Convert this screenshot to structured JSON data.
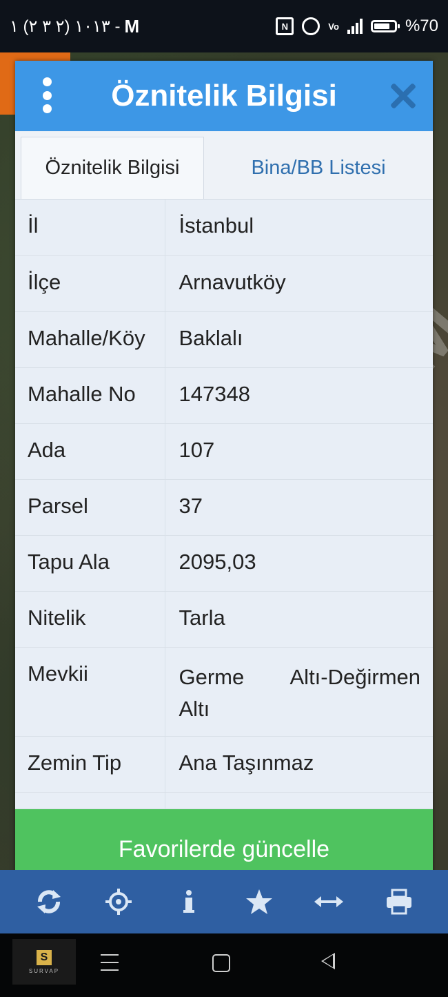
{
  "status_bar": {
    "left_text": "۱ (۲ ۳ ۲) ۱۰۱۳ -",
    "m_icon": "M",
    "battery": "%70",
    "icons": [
      "nfc-icon",
      "alarm-icon",
      "volte-icon",
      "signal-icon",
      "battery-icon"
    ]
  },
  "dialog": {
    "title": "Öznitelik Bilgisi",
    "tabs": [
      {
        "label": "Öznitelik Bilgisi",
        "active": true
      },
      {
        "label": "Bina/BB Listesi",
        "active": false
      }
    ],
    "rows": [
      {
        "key": "İl",
        "value": "İstanbul"
      },
      {
        "key": "İlçe",
        "value": "Arnavutköy"
      },
      {
        "key": "Mahalle/Köy",
        "value": "Baklalı"
      },
      {
        "key": "Mahalle No",
        "value": "147348"
      },
      {
        "key": "Ada",
        "value": "107"
      },
      {
        "key": "Parsel",
        "value": "37"
      },
      {
        "key": "Tapu Ala",
        "value": "2095,03"
      },
      {
        "key": "Nitelik",
        "value": "Tarla"
      },
      {
        "key": "Mevkii",
        "value": "Germe Altı-Değirmen Altı"
      },
      {
        "key": "Zemin Tip",
        "value": "Ana Taşınmaz"
      }
    ],
    "mevkii_parts": [
      "Germe",
      "Altı-Değirmen",
      "Altı"
    ],
    "favorite_button": "Favorilerde güncelle"
  },
  "toolbar": {
    "icons": [
      "refresh-icon",
      "locate-icon",
      "info-icon",
      "star-icon",
      "measure-icon",
      "print-icon"
    ]
  },
  "watermark": "ADVERT.COM",
  "logo_text": "SURVAP",
  "colors": {
    "header_blue": "#3d97e6",
    "button_green": "#4fc35f",
    "toolbar_blue": "#2f5fa2",
    "tab_link": "#2f6fae"
  }
}
